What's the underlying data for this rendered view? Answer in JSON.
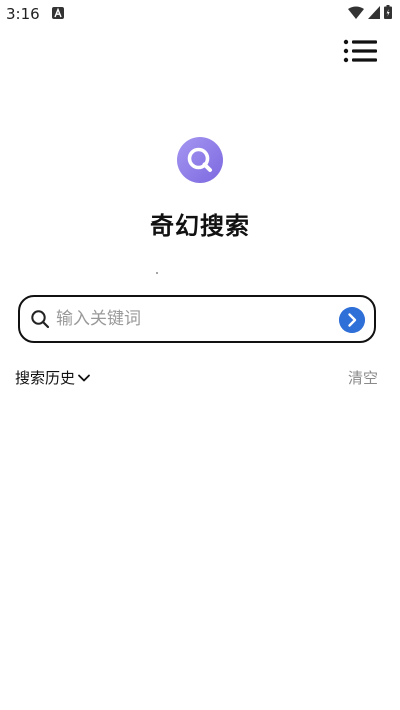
{
  "status_bar": {
    "time": "3:16",
    "icons": [
      "notification-a-icon",
      "wifi-icon",
      "cellular-icon",
      "battery-icon"
    ]
  },
  "header": {
    "menu_icon": "menu-list-icon"
  },
  "app": {
    "logo_icon": "search-logo-icon",
    "title": "奇幻搜索"
  },
  "search": {
    "placeholder": "输入关键词",
    "value": "",
    "submit_icon": "arrow-right-icon"
  },
  "history": {
    "label": "搜索历史",
    "toggle_icon": "chevron-down-icon",
    "clear_label": "清空"
  },
  "colors": {
    "accent": "#2f6fd8",
    "logo": "#8f7ce8",
    "muted_text": "#8a8a8a"
  }
}
